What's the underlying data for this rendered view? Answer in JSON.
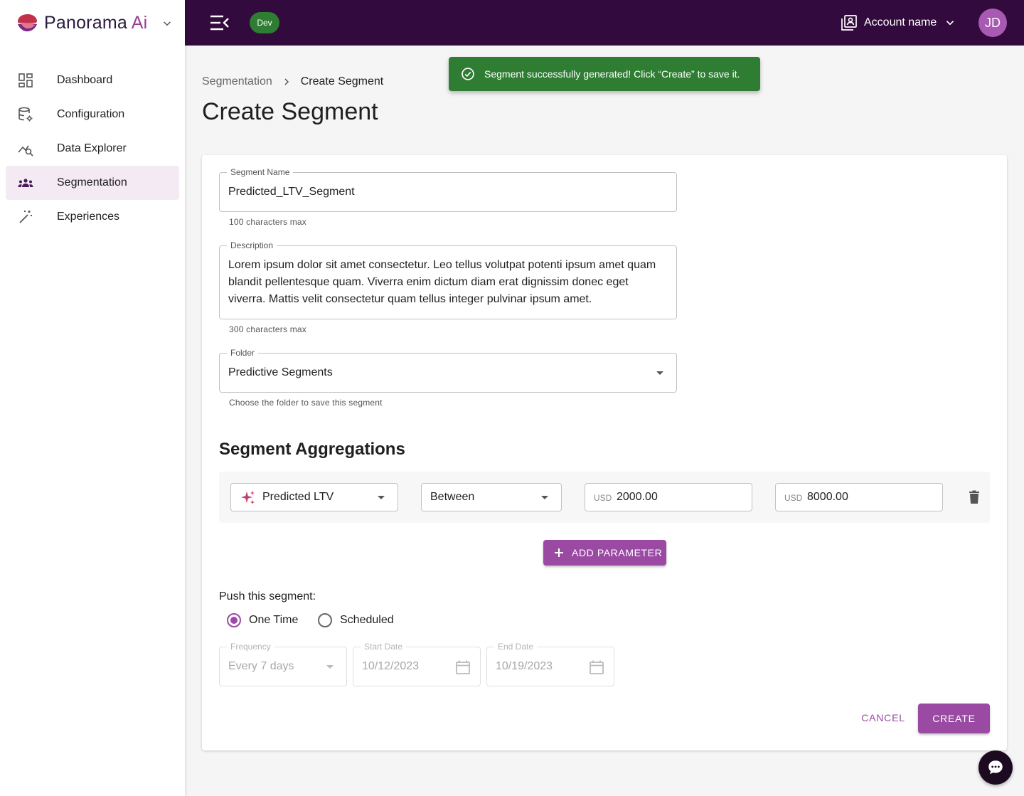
{
  "brand": {
    "name_main": "Panorama",
    "name_accent": "Ai"
  },
  "sidebar": {
    "items": [
      {
        "label": "Dashboard",
        "icon": "dashboard-icon",
        "active": false
      },
      {
        "label": "Configuration",
        "icon": "database-gear-icon",
        "active": false
      },
      {
        "label": "Data Explorer",
        "icon": "chart-search-icon",
        "active": false
      },
      {
        "label": "Segmentation",
        "icon": "groups-icon",
        "active": true
      },
      {
        "label": "Experiences",
        "icon": "magic-wand-icon",
        "active": false
      }
    ]
  },
  "topbar": {
    "env_badge": "Dev",
    "account_name": "Account name",
    "avatar_initials": "JD"
  },
  "toast": {
    "message": "Segment successfully generated! Click “Create” to save it."
  },
  "breadcrumb": {
    "parent": "Segmentation",
    "current": "Create Segment"
  },
  "page_title": "Create Segment",
  "form": {
    "segment_name": {
      "label": "Segment Name",
      "value": "Predicted_LTV_Segment",
      "helper": "100 characters max"
    },
    "description": {
      "label": "Description",
      "value": "Lorem ipsum dolor sit amet consectetur. Leo tellus volutpat potenti ipsum amet quam blandit pellentesque quam. Viverra enim dictum diam erat dignissim donec eget viverra. Mattis velit consectetur quam tellus integer pulvinar ipsum amet.",
      "helper": "300 characters max"
    },
    "folder": {
      "label": "Folder",
      "value": "Predictive Segments",
      "helper": "Choose the folder to save this segment"
    }
  },
  "aggregations": {
    "title": "Segment Aggregations",
    "rows": [
      {
        "attribute": "Predicted LTV",
        "operator": "Between",
        "currency": "USD",
        "min": "2000.00",
        "max": "8000.00"
      }
    ],
    "add_button": "ADD PARAMETER"
  },
  "push": {
    "label": "Push this segment:",
    "options": [
      {
        "label": "One Time",
        "checked": true
      },
      {
        "label": "Scheduled",
        "checked": false
      }
    ],
    "frequency": {
      "label": "Frequency",
      "value": "Every 7 days"
    },
    "start_date": {
      "label": "Start Date",
      "value": "10/12/2023"
    },
    "end_date": {
      "label": "End Date",
      "value": "10/19/2023"
    }
  },
  "actions": {
    "cancel": "CANCEL",
    "create": "CREATE"
  },
  "colors": {
    "topbar": "#330a3d",
    "primary": "#9b4aa3",
    "success": "#2e7d32",
    "accent": "#9c3d8f"
  }
}
